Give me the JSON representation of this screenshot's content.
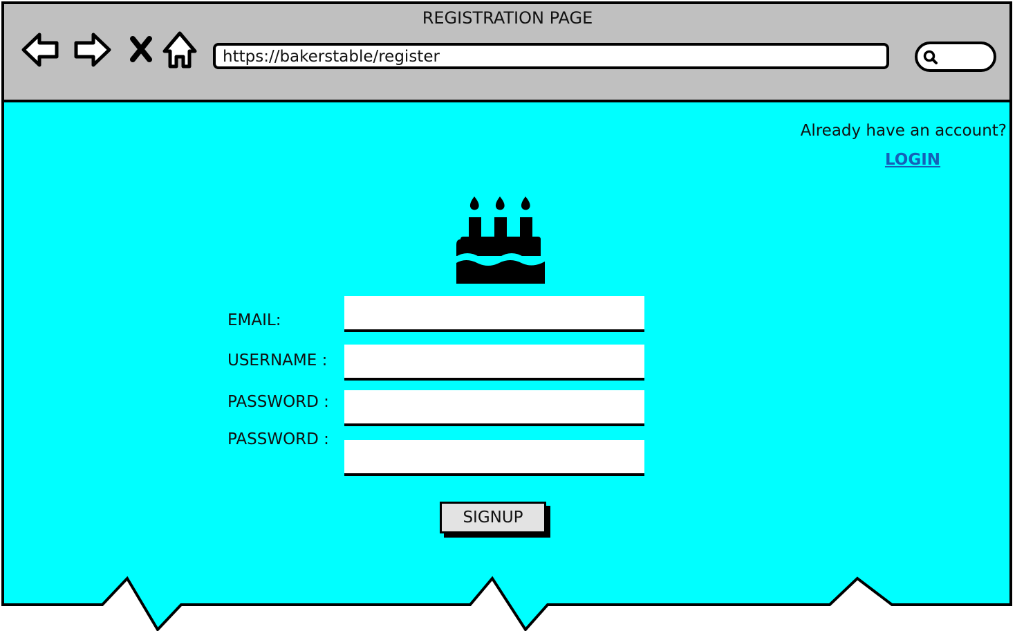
{
  "window": {
    "title": "REGISTRATION PAGE",
    "url": "https://bakerstable/register"
  },
  "toolbar": {
    "back_icon": "back-arrow-icon",
    "forward_icon": "forward-arrow-icon",
    "stop_icon": "close-x-icon",
    "home_icon": "home-icon",
    "search_icon": "search-icon"
  },
  "header": {
    "account_prompt": "Already have an account?",
    "login_label": "LOGIN"
  },
  "logo": {
    "icon": "birthday-cake-icon"
  },
  "form": {
    "fields": [
      {
        "label": "EMAIL:",
        "value": ""
      },
      {
        "label": "USERNAME :",
        "value": ""
      },
      {
        "label": "PASSWORD :",
        "value": ""
      },
      {
        "label": "PASSWORD :",
        "value": ""
      }
    ],
    "submit_label": "SIGNUP"
  },
  "colors": {
    "page_background": "#00ffff",
    "titlebar_background": "#c0c0c0",
    "link": "#1560b8",
    "button_background": "#e3e3e3"
  }
}
